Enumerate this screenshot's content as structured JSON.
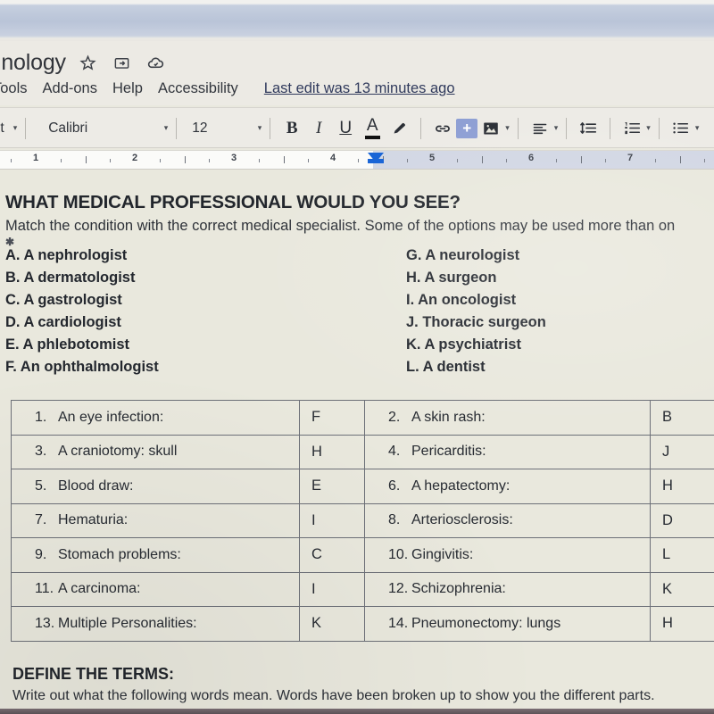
{
  "window": {
    "doc_title": "inology",
    "title_icons": [
      "star-icon",
      "move-to-folder-icon",
      "cloud-saved-icon"
    ]
  },
  "menubar": {
    "items": [
      "Tools",
      "Add-ons",
      "Help",
      "Accessibility"
    ],
    "last_edit": "Last edit was 13 minutes ago"
  },
  "toolbar": {
    "style": "ext",
    "font": "Calibri",
    "size": "12",
    "bold": "B",
    "italic": "I",
    "underline": "U",
    "text_color": "A",
    "highlight_icon": "highlight-pencil-icon",
    "link_icon": "insert-link-icon",
    "comment_icon": "add-comment-icon",
    "comment_glyph": "+",
    "image_icon": "insert-image-icon",
    "align_icon": "align-left-icon",
    "line_spacing_icon": "line-spacing-icon",
    "numbered_list_icon": "numbered-list-icon",
    "bulleted_list_icon": "bulleted-list-icon",
    "caret": "▾"
  },
  "ruler": {
    "numbers": [
      "1",
      "2",
      "3",
      "4",
      "5",
      "6",
      "7"
    ],
    "indent_marker_at": "4"
  },
  "document": {
    "heading": "WHAT MEDICAL PROFESSIONAL WOULD YOU SEE?",
    "instructions": "Match the condition with the correct medical specialist.   Some of the options may be used more than on",
    "stray_mark": "✱",
    "options_left": [
      "A. A nephrologist",
      "B. A dermatologist",
      "C.  A gastrologist",
      "D.  A cardiologist",
      "E.  A phlebotomist",
      "F. An ophthalmologist"
    ],
    "options_right": [
      "G.  A neurologist",
      "H.  A surgeon",
      "I.  An oncologist",
      "J.  Thoracic surgeon",
      "K.  A psychiatrist",
      "L.  A dentist"
    ],
    "table_rows": [
      {
        "q1": "1.",
        "t1": "An eye infection:",
        "a1": "F",
        "q2": "2.",
        "t2": "A skin rash:",
        "a2": "B"
      },
      {
        "q1": "3.",
        "t1": "A craniotomy: skull",
        "a1": "H",
        "q2": "4.",
        "t2": "Pericarditis:",
        "a2": "J"
      },
      {
        "q1": "5.",
        "t1": "Blood draw:",
        "a1": "E",
        "q2": "6.",
        "t2": "A hepatectomy:",
        "a2": "H"
      },
      {
        "q1": "7.",
        "t1": "Hematuria:",
        "a1": "I",
        "q2": "8.",
        "t2": "Arteriosclerosis:",
        "a2": "D"
      },
      {
        "q1": "9.",
        "t1": "Stomach problems:",
        "a1": "C",
        "q2": "10.",
        "t2": "Gingivitis:",
        "a2": "L"
      },
      {
        "q1": "11.",
        "t1": "A carcinoma:",
        "a1": "I",
        "q2": "12.",
        "t2": "Schizophrenia:",
        "a2": "K"
      },
      {
        "q1": "13.",
        "t1": "Multiple Personalities:",
        "a1": "K",
        "q2": "14.",
        "t2": "Pneumonectomy: lungs",
        "a2": "H"
      }
    ],
    "define_heading": "DEFINE THE TERMS:",
    "define_sub": "Write out what the following words mean.  Words have been broken up to show you the different parts."
  },
  "colors": {
    "page_background": "#e9e8dd",
    "chrome_blue": "#b9c4d8",
    "accent_blue": "#1763d6",
    "comment_button": "#8e9fd4",
    "link_text": "#303a5c"
  }
}
